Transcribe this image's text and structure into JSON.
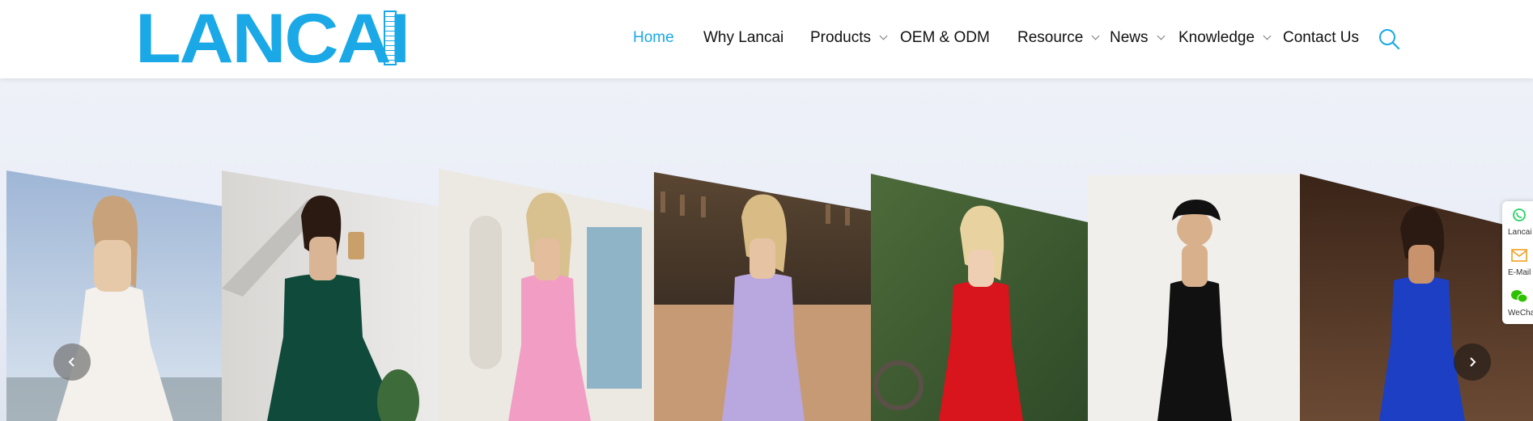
{
  "brand": {
    "logo_text": "LANCAI",
    "color": "#1aa9e6"
  },
  "nav": {
    "items": [
      {
        "label": "Home",
        "active": true,
        "dropdown": false
      },
      {
        "label": "Why Lancai",
        "active": false,
        "dropdown": false
      },
      {
        "label": "Products",
        "active": false,
        "dropdown": true
      },
      {
        "label": "OEM & ODM",
        "active": false,
        "dropdown": false
      },
      {
        "label": "Resource",
        "active": false,
        "dropdown": true
      },
      {
        "label": "News",
        "active": false,
        "dropdown": true
      },
      {
        "label": "Knowledge",
        "active": false,
        "dropdown": true
      },
      {
        "label": "Contact Us",
        "active": false,
        "dropdown": false
      }
    ],
    "search_icon": "search-icon"
  },
  "hero": {
    "slides": [
      {
        "dress": "white strapless gown",
        "color": "#f4f1ec"
      },
      {
        "dress": "emerald green off-shoulder dress",
        "color": "#0f4a3a"
      },
      {
        "dress": "pink bodycon midi dress",
        "color": "#f29ec4"
      },
      {
        "dress": "lavender satin slip dress",
        "color": "#b9a7e0"
      },
      {
        "dress": "red strapless mermaid dress",
        "color": "#d8141c"
      },
      {
        "dress": "black slip maxi dress",
        "color": "#111111"
      },
      {
        "dress": "royal blue corset gown",
        "color": "#1c3fc4"
      }
    ],
    "prev_icon": "chevron-left-icon",
    "next_icon": "chevron-right-icon"
  },
  "contact_widget": {
    "items": [
      {
        "label": "Lancai",
        "icon": "whatsapp-icon",
        "color": "#25d366"
      },
      {
        "label": "E-Mail",
        "icon": "mail-icon",
        "color": "#f0a020"
      },
      {
        "label": "WeChat",
        "icon": "wechat-icon",
        "color": "#2dc100"
      }
    ]
  }
}
